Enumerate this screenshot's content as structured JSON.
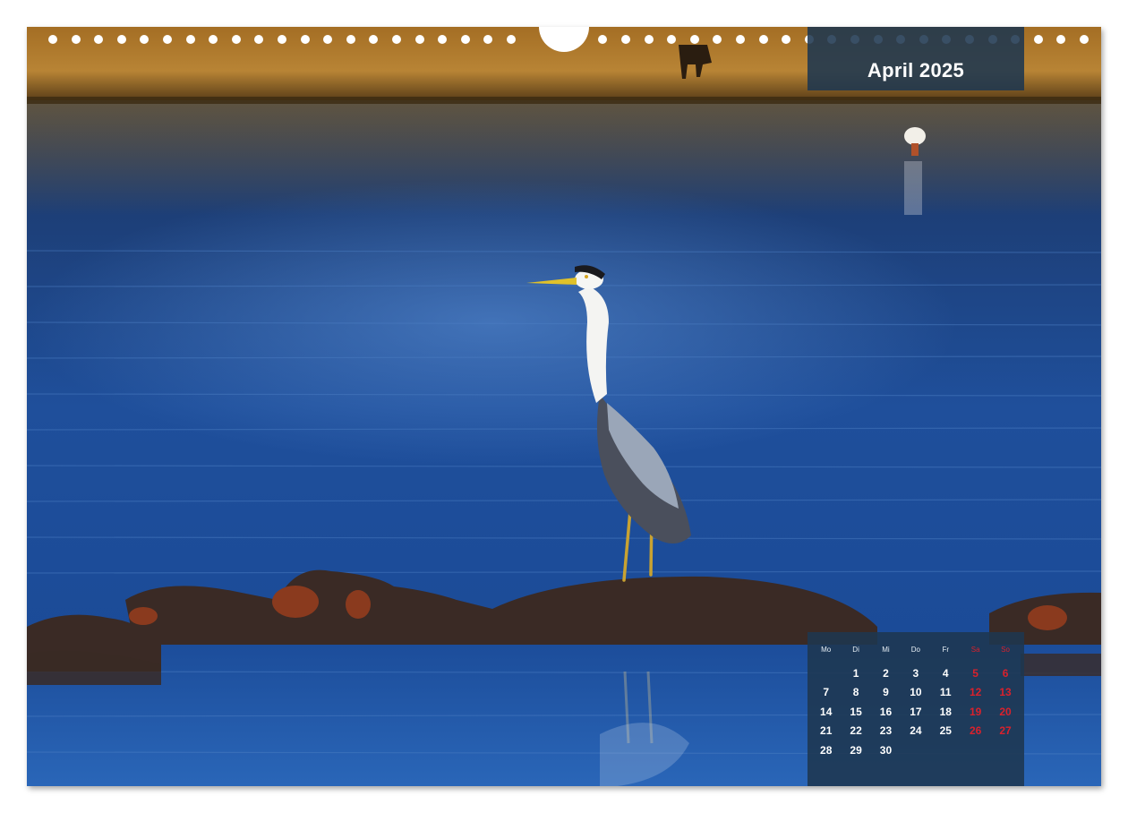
{
  "calendar": {
    "title": "April 2025",
    "weekday_headers": [
      "Mo",
      "Di",
      "Mi",
      "Do",
      "Fr",
      "Sa",
      "So"
    ],
    "weekend_color": "#d9212c",
    "panel_color": "#1e3750",
    "start_offset": 1,
    "days": [
      "1",
      "2",
      "3",
      "4",
      "5",
      "6",
      "7",
      "8",
      "9",
      "10",
      "11",
      "12",
      "13",
      "14",
      "15",
      "16",
      "17",
      "18",
      "19",
      "20",
      "21",
      "22",
      "23",
      "24",
      "25",
      "26",
      "27",
      "28",
      "29",
      "30"
    ]
  },
  "photo": {
    "water_color": "#1d4f9a",
    "shore_color": "#b07a2a"
  }
}
